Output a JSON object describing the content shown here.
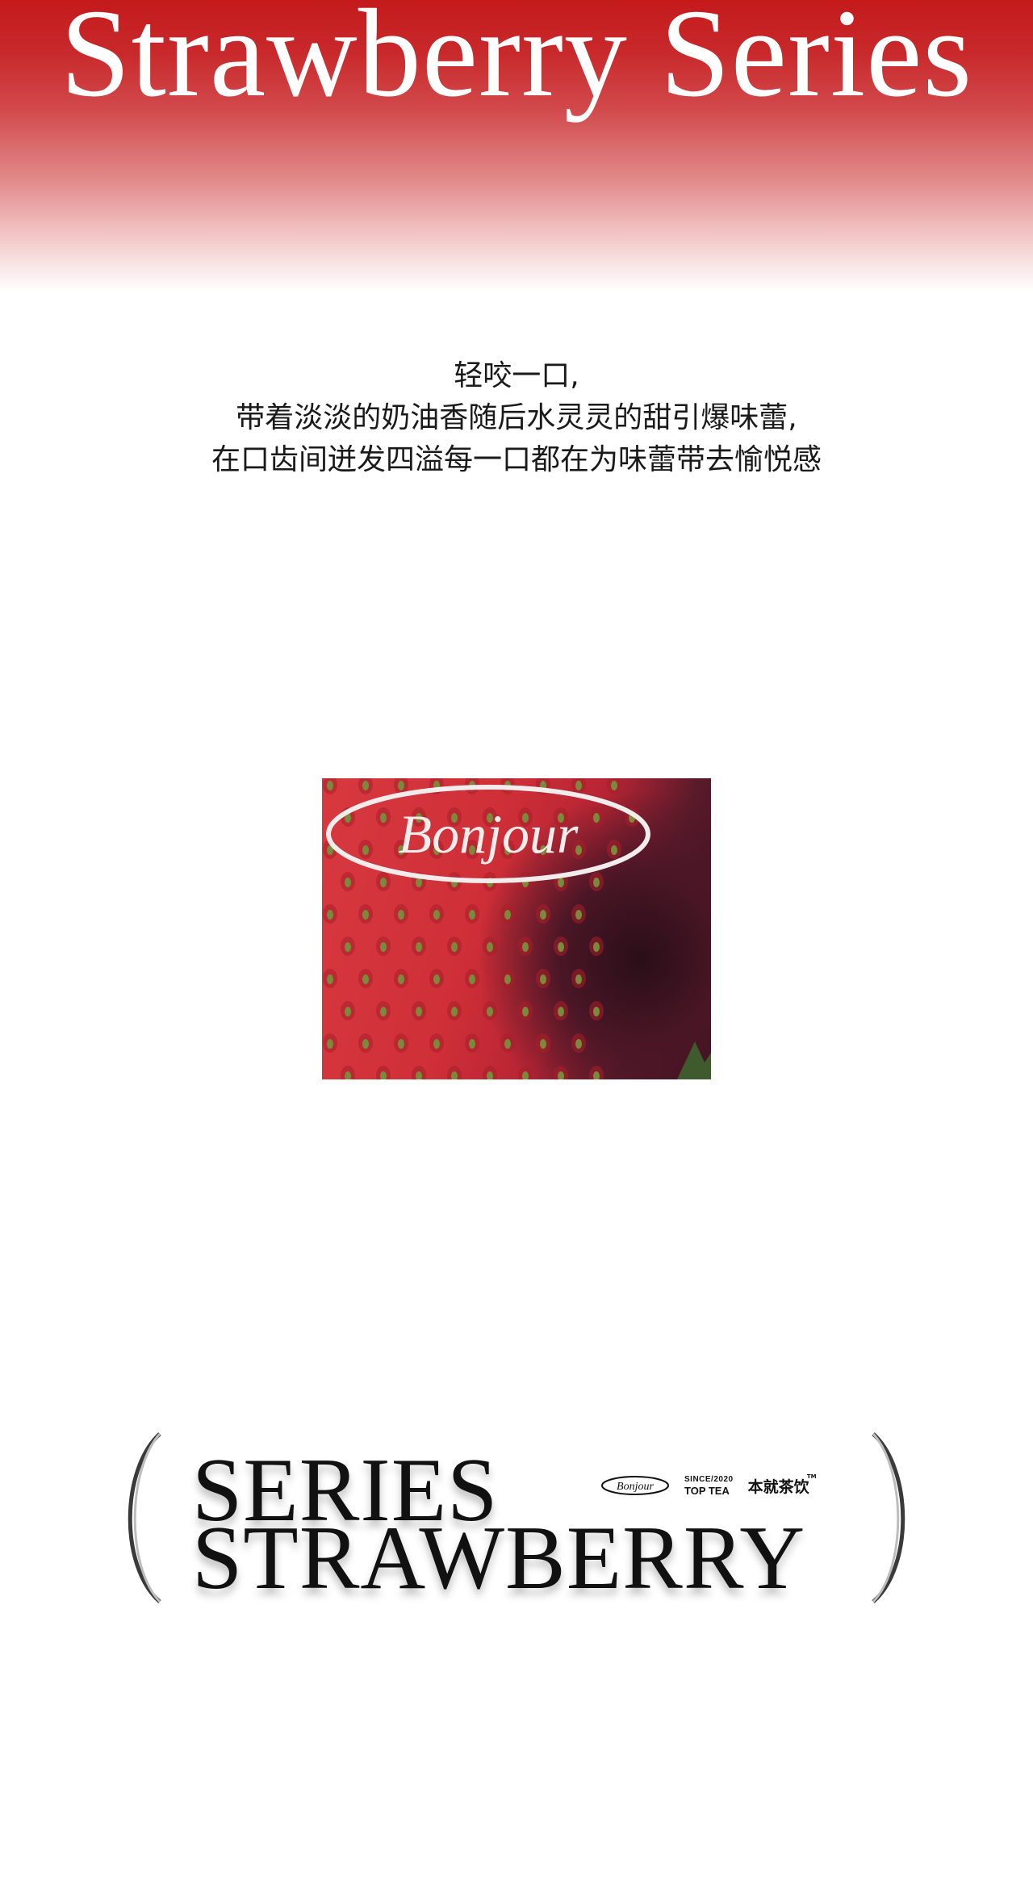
{
  "header": {
    "title": "Strawberry Series",
    "gradient_top": "#c41a1c"
  },
  "intro": {
    "lines": [
      "轻咬一口,",
      "带着淡淡的奶油香随后水灵灵的甜引爆味蕾,",
      "在口齿间迸发四溢每一口都在为味蕾带去愉悦感"
    ]
  },
  "photo": {
    "logo_text": "Bonjour",
    "subject": "strawberry close-up"
  },
  "emblem": {
    "line1": "SERIES",
    "line2": "STRAWBERRY",
    "mini_logo": "Bonjour",
    "since_line1": "SINCE/2020",
    "since_line2": "TOP TEA",
    "cn_brand": "本就茶饮",
    "trademark": "TM"
  }
}
